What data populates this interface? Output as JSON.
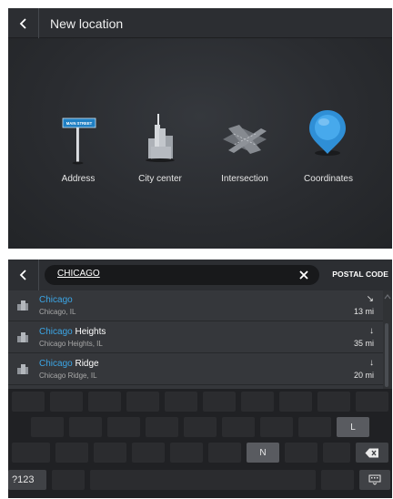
{
  "top_panel": {
    "title": "New location",
    "options": [
      {
        "label": "Address",
        "icon": "street-sign-icon",
        "sign_text": "MAIN STREET"
      },
      {
        "label": "City center",
        "icon": "city-buildings-icon"
      },
      {
        "label": "Intersection",
        "icon": "intersection-icon"
      },
      {
        "label": "Coordinates",
        "icon": "map-pin-icon"
      }
    ]
  },
  "bottom_panel": {
    "search_value": "CHICAGO",
    "postal_code_label": "POSTAL CODE",
    "results": [
      {
        "match": "Chicago",
        "rest": "",
        "subtitle": "Chicago, IL",
        "direction": "↘",
        "distance": "13 mi"
      },
      {
        "match": "Chicago",
        "rest": " Heights",
        "subtitle": "Chicago Heights, IL",
        "direction": "↓",
        "distance": "35 mi"
      },
      {
        "match": "Chicago",
        "rest": " Ridge",
        "subtitle": "Chicago Ridge, IL",
        "direction": "↓",
        "distance": "20 mi"
      }
    ],
    "keyboard": {
      "highlighted_keys": {
        "l": "L",
        "n": "N"
      },
      "numeric_key": "?123",
      "backspace_icon": "backspace-icon",
      "hide_keyboard_icon": "keyboard-hide-icon"
    }
  },
  "colors": {
    "accent": "#3ca6e6",
    "background": "#2a2c30"
  }
}
